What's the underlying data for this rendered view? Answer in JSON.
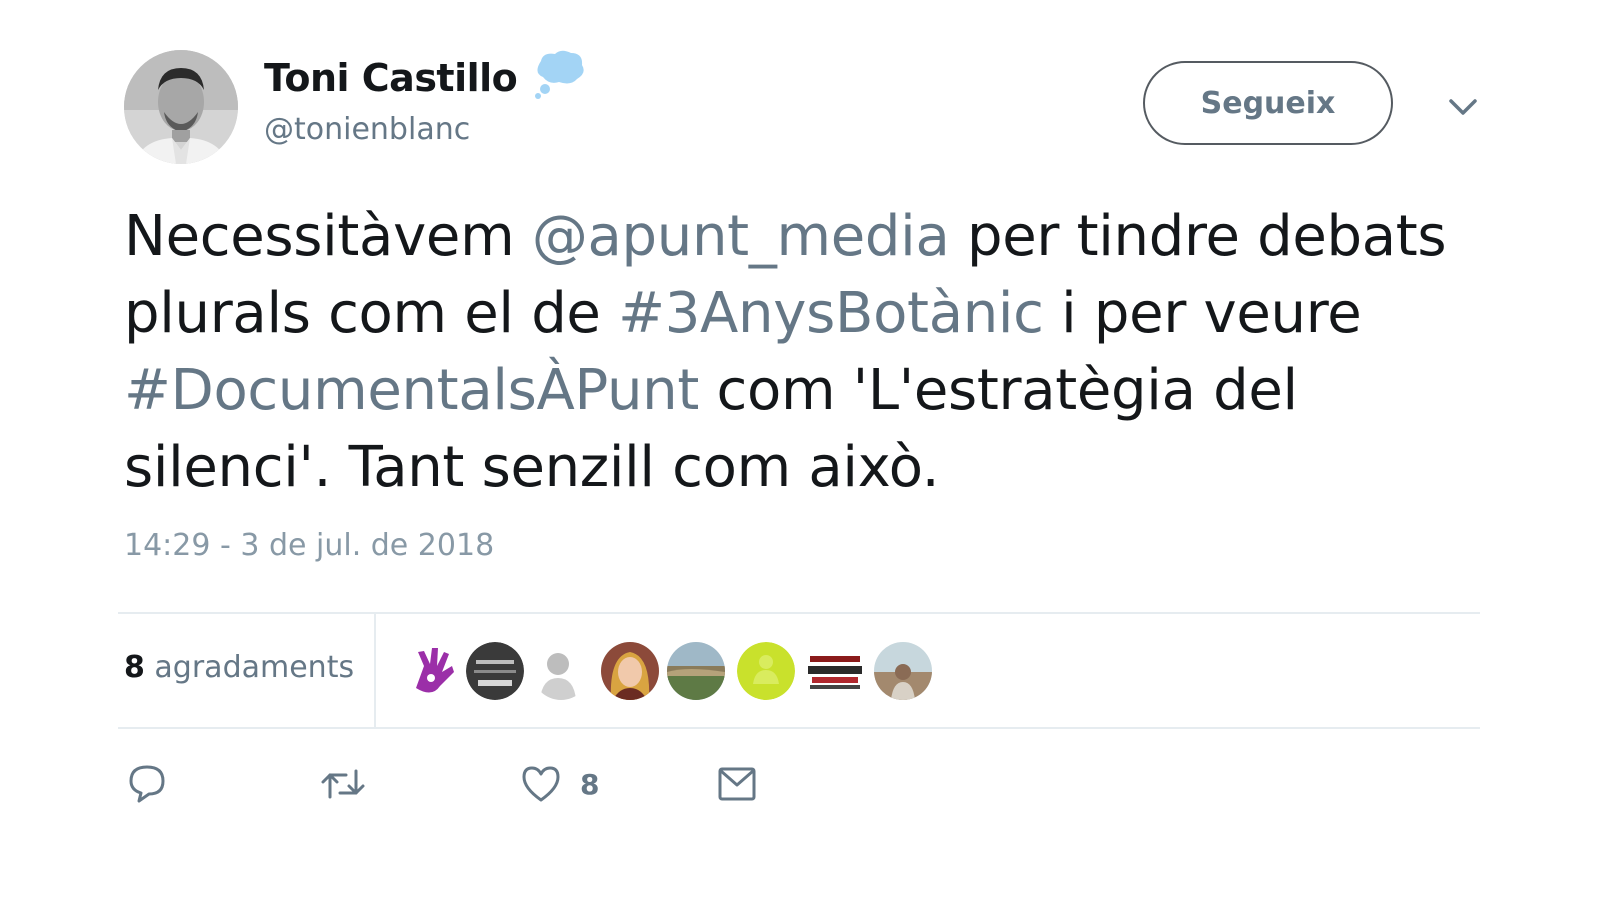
{
  "user": {
    "display_name": "Toni Castillo",
    "handle": "@tonienblanc",
    "badge_icon": "speech-bubble-icon",
    "badge_color": "#a3d4f5"
  },
  "actions": {
    "follow_label": "Segueix",
    "menu_icon": "chevron-down-icon"
  },
  "tweet": {
    "text_parts": [
      {
        "text": "Necessitàvem ",
        "type": "text"
      },
      {
        "text": "@apunt_media",
        "type": "mention"
      },
      {
        "text": " per tindre debats plurals com el de ",
        "type": "text"
      },
      {
        "text": "#3AnysBotànic",
        "type": "hashtag"
      },
      {
        "text": " i per veure ",
        "type": "text"
      },
      {
        "text": "#DocumentalsÀPunt",
        "type": "hashtag"
      },
      {
        "text": " com 'L'estratègia del silenci'. Tant senzill com això.",
        "type": "text"
      }
    ],
    "timestamp": "14:29 - 3 de jul. de 2018"
  },
  "stats": {
    "likes_count": "8",
    "likes_label": "agradaments",
    "likers": [
      {
        "name": "purple-hand-avatar"
      },
      {
        "name": "dark-badge-avatar"
      },
      {
        "name": "grey-person-avatar"
      },
      {
        "name": "woman-portrait-avatar"
      },
      {
        "name": "landscape-avatar"
      },
      {
        "name": "yellow-figure-avatar"
      },
      {
        "name": "text-logo-avatar"
      },
      {
        "name": "sky-person-avatar"
      }
    ]
  },
  "footer": {
    "reply_icon": "reply-icon",
    "retweet_icon": "retweet-icon",
    "like_icon": "heart-icon",
    "like_count": "8",
    "dm_icon": "envelope-icon"
  },
  "colors": {
    "text": "#14171a",
    "secondary": "#657786",
    "muted": "#8899a6",
    "divider": "#e6ecf0"
  }
}
